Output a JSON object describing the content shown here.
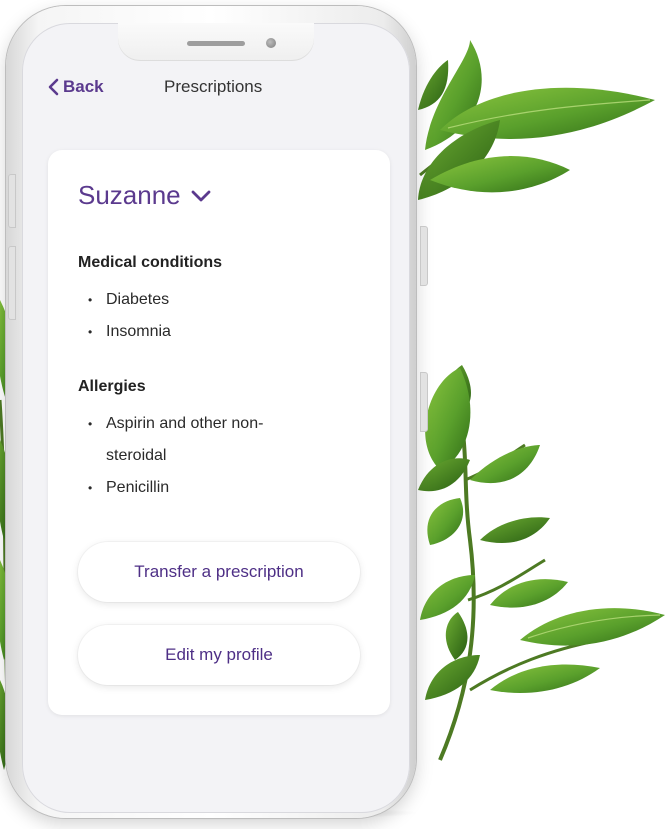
{
  "nav": {
    "back_label": "Back",
    "title": "Prescriptions"
  },
  "profile": {
    "name": "Suzanne",
    "dropdown_icon": "chevron-down-icon"
  },
  "medical_conditions": {
    "title": "Medical conditions",
    "items": [
      "Diabetes",
      "Insomnia"
    ]
  },
  "allergies": {
    "title": "Allergies",
    "items": [
      "Aspirin and other non-steroidal",
      "Penicillin"
    ]
  },
  "actions": {
    "transfer_label": "Transfer a prescription",
    "edit_label": "Edit my profile"
  },
  "colors": {
    "accent": "#5b3a8e",
    "screen_background": "#f3f3f6",
    "card_background": "#ffffff",
    "leaf_green": "#5aa02c"
  }
}
